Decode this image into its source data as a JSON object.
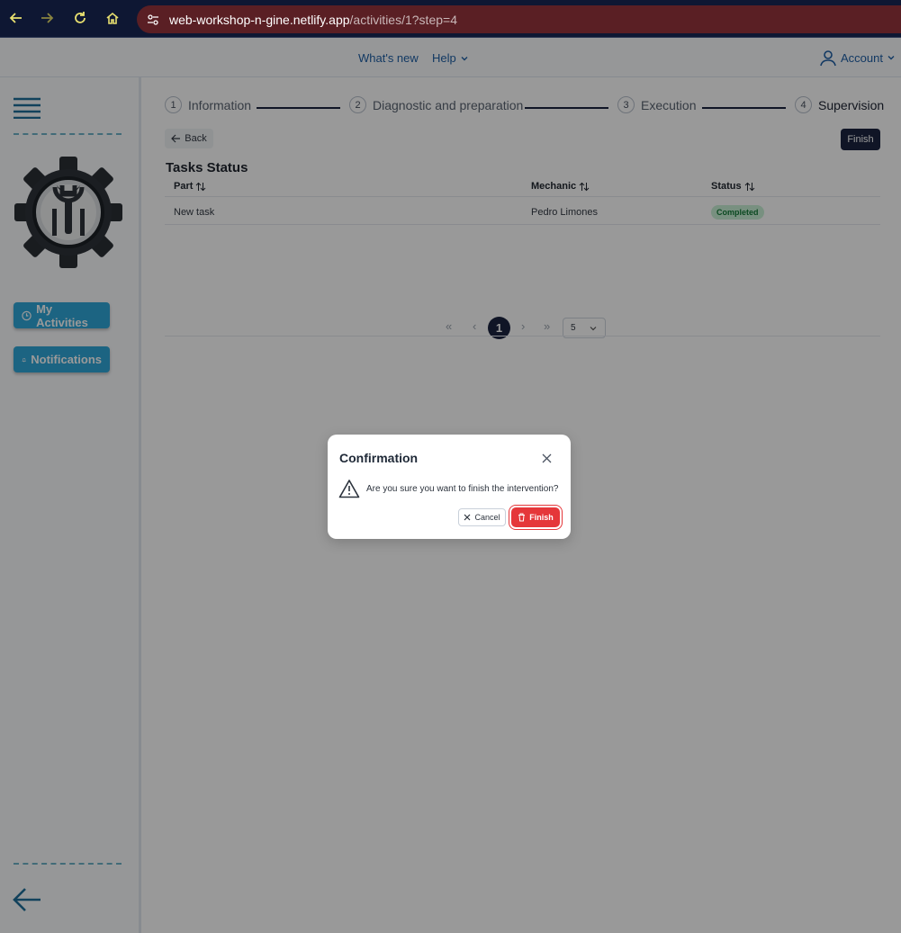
{
  "browser": {
    "url_host": "web-workshop-n-gine.netlify.app",
    "url_path": "/activities/1?step=4"
  },
  "topnav": {
    "whats_new": "What's new",
    "help": "Help",
    "account": "Account"
  },
  "sidebar": {
    "my_activities": "My Activities",
    "notifications": "Notifications"
  },
  "stepper": {
    "steps": [
      {
        "num": "1",
        "label": "Information"
      },
      {
        "num": "2",
        "label": "Diagnostic and preparation"
      },
      {
        "num": "3",
        "label": "Execution"
      },
      {
        "num": "4",
        "label": "Supervision"
      }
    ]
  },
  "toolbar": {
    "back": "Back",
    "finish": "Finish"
  },
  "tasks": {
    "title": "Tasks Status",
    "columns": [
      "Part",
      "Mechanic",
      "Status"
    ],
    "rows": [
      {
        "part": "New task",
        "mechanic": "Pedro Limones",
        "status": "Completed"
      }
    ],
    "pager": {
      "first": "«",
      "prev": "‹",
      "current": "1",
      "next": "›",
      "last": "»",
      "rows_per_page": "5"
    }
  },
  "dialog": {
    "title": "Confirmation",
    "message": "Are you sure you want to finish the intervention?",
    "cancel": "Cancel",
    "finish": "Finish"
  },
  "colors": {
    "primary": "#1b2340",
    "accent": "#2fa7d9",
    "danger": "#e5373a",
    "success_bg": "#c9f1d6"
  }
}
